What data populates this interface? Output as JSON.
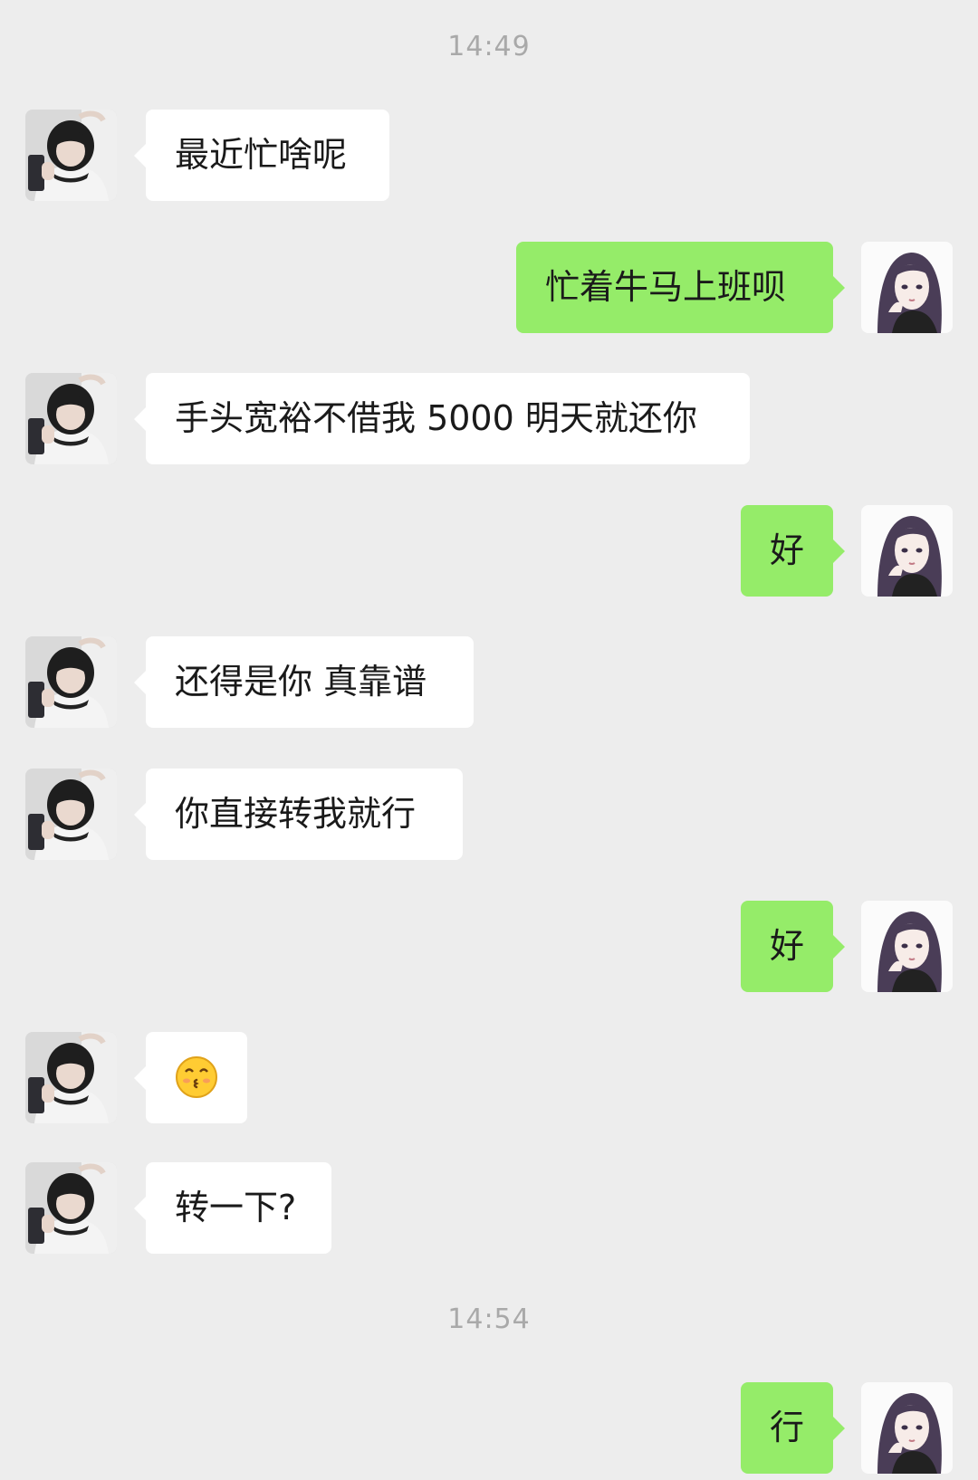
{
  "chat": {
    "timestamps": [
      "14:49",
      "14:54"
    ],
    "messages": [
      {
        "side": "recv",
        "text": "最近忙啥呢"
      },
      {
        "side": "sent",
        "text": "忙着牛马上班呗"
      },
      {
        "side": "recv",
        "text": "手头宽裕不借我 5000 明天就还你"
      },
      {
        "side": "sent",
        "text": "好"
      },
      {
        "side": "recv",
        "text": "还得是你 真靠谱"
      },
      {
        "side": "recv",
        "text": "你直接转我就行"
      },
      {
        "side": "sent",
        "text": "好"
      },
      {
        "side": "recv",
        "emoji": "kissing-face-emoji"
      },
      {
        "side": "recv",
        "text": "转一下?"
      },
      {
        "side": "sent",
        "text": "行"
      }
    ]
  },
  "colors": {
    "background": "#ededed",
    "sent_bubble": "#95ec69",
    "received_bubble": "#ffffff",
    "timestamp_text": "#a9a9a9"
  }
}
